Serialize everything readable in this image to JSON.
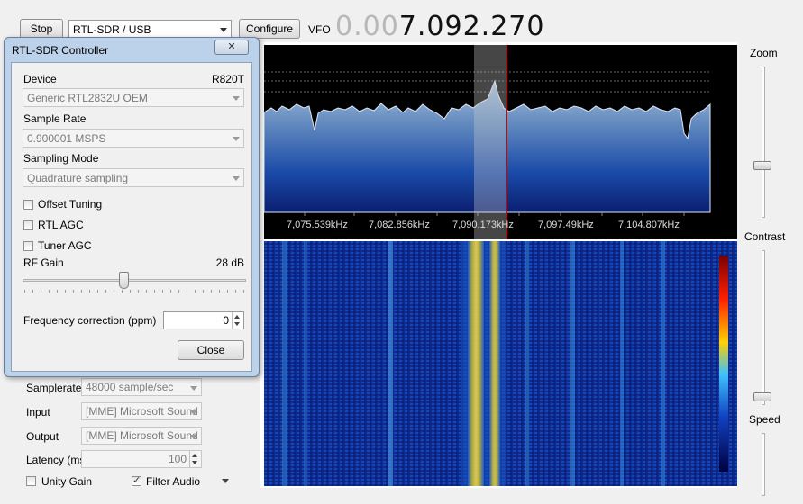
{
  "toolbar": {
    "stop_label": "Stop",
    "source_value": "RTL-SDR / USB",
    "configure_label": "Configure",
    "vfo_label": "VFO",
    "vfo_dim": "0.00",
    "vfo_bright": "7.092.270"
  },
  "right_panel": {
    "zoom_label": "Zoom",
    "contrast_label": "Contrast",
    "speed_label": "Speed"
  },
  "spectrum": {
    "freq_labels": [
      "7,075.539kHz",
      "7,082.856kHz",
      "7,090.173kHz",
      "7,097.49kHz",
      "7,104.807kHz"
    ]
  },
  "audio_panel": {
    "samplerate_label": "Samplerate",
    "samplerate_value": "48000 sample/sec",
    "input_label": "Input",
    "input_value": "[MME] Microsoft Sound",
    "output_label": "Output",
    "output_value": "[MME] Microsoft Sound",
    "latency_label": "Latency (ms)",
    "latency_value": "100",
    "unity_gain_label": "Unity Gain",
    "unity_gain_checked": false,
    "filter_audio_label": "Filter Audio",
    "filter_audio_checked": true
  },
  "dialog": {
    "title": "RTL-SDR Controller",
    "close_x": "✕",
    "device_label": "Device",
    "device_tuner": "R820T",
    "device_value": "Generic RTL2832U OEM",
    "sample_rate_label": "Sample Rate",
    "sample_rate_value": "0.900001 MSPS",
    "sampling_mode_label": "Sampling Mode",
    "sampling_mode_value": "Quadrature sampling",
    "offset_tuning_label": "Offset Tuning",
    "rtl_agc_label": "RTL AGC",
    "tuner_agc_label": "Tuner AGC",
    "rf_gain_label": "RF Gain",
    "rf_gain_value": "28 dB",
    "rf_gain_level": 0.45,
    "freq_correction_label": "Frequency correction (ppm)",
    "freq_correction_value": "0",
    "close_label": "Close"
  },
  "colors": {
    "accent": "#d40000",
    "spectrum_fill_top": "#9fb9d6",
    "spectrum_fill_bottom": "#0a2a8a",
    "waterfall_bg": "#0b1a63"
  }
}
